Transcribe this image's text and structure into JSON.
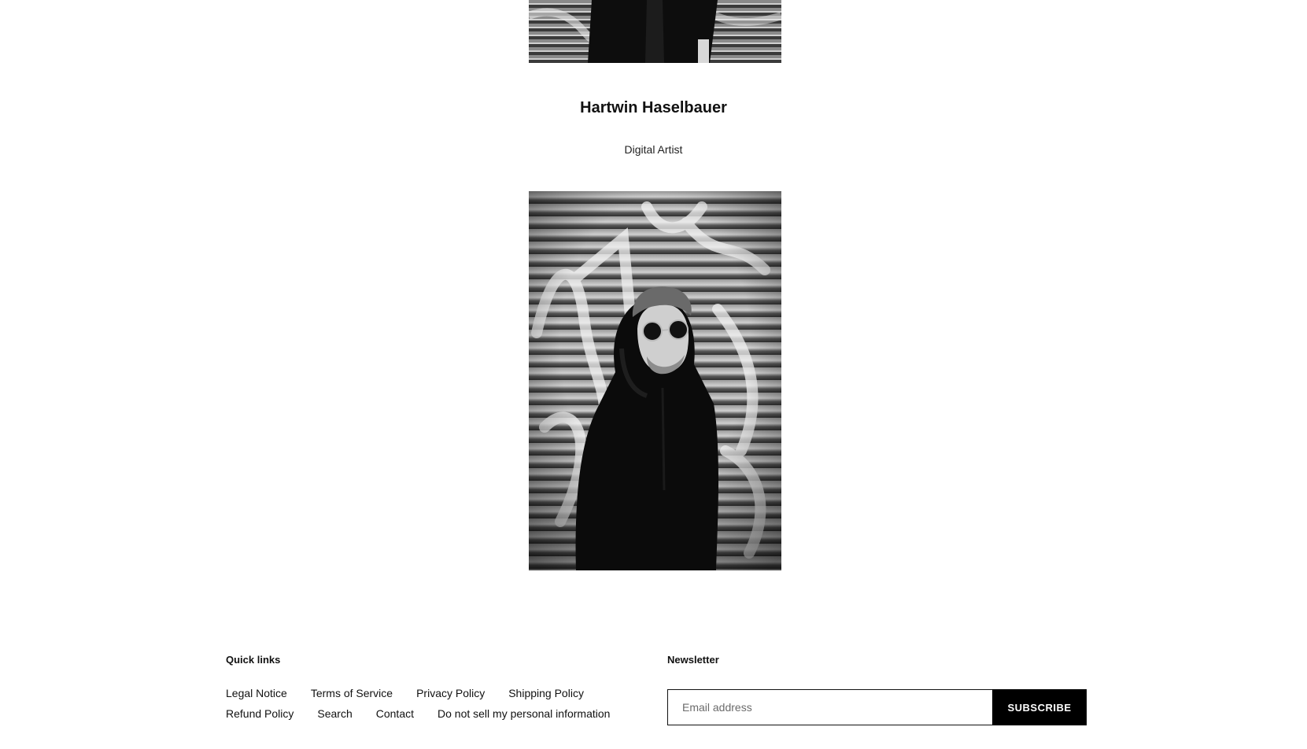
{
  "artist": {
    "name": "Hartwin Haselbauer",
    "role": "Digital Artist"
  },
  "footer": {
    "quick_links": {
      "heading": "Quick links",
      "items": [
        {
          "label": "Legal Notice"
        },
        {
          "label": "Terms of Service"
        },
        {
          "label": "Privacy Policy"
        },
        {
          "label": "Shipping Policy"
        },
        {
          "label": "Refund Policy"
        },
        {
          "label": "Search"
        },
        {
          "label": "Contact"
        },
        {
          "label": "Do not sell my personal information"
        }
      ]
    },
    "newsletter": {
      "heading": "Newsletter",
      "email_placeholder": "Email address",
      "email_value": "",
      "subscribe_label": "SUBSCRIBE"
    }
  },
  "colors": {
    "background": "#ffffff",
    "text": "#111111",
    "button_bg": "#000000",
    "button_text": "#ffffff"
  }
}
